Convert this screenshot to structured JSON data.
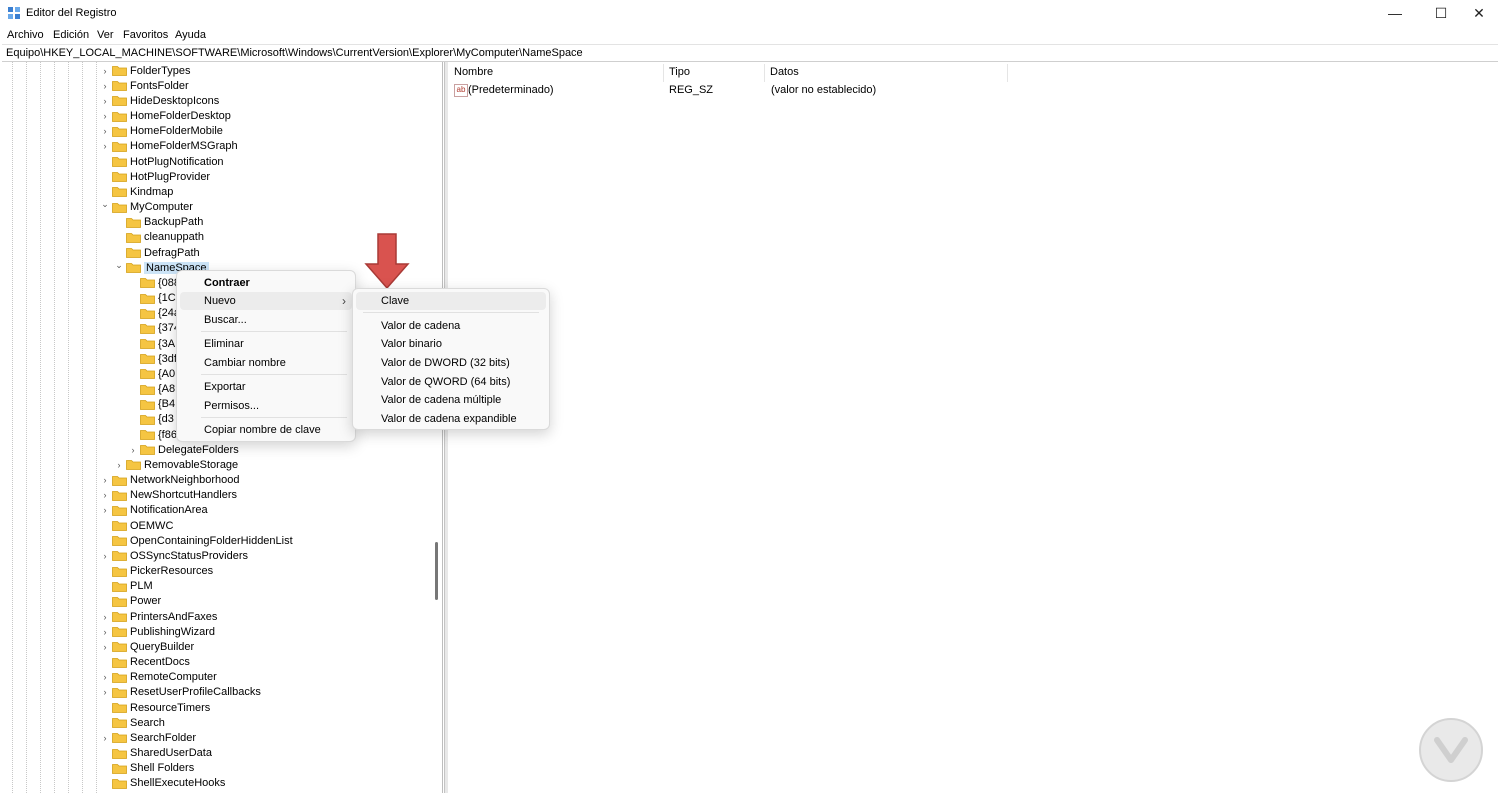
{
  "window": {
    "title": "Editor del Registro",
    "controls": {
      "minimize": "—",
      "maximize": "☐",
      "close": "✕"
    }
  },
  "menu": [
    "Archivo",
    "Edición",
    "Ver",
    "Favoritos",
    "Ayuda"
  ],
  "address": "Equipo\\HKEY_LOCAL_MACHINE\\SOFTWARE\\Microsoft\\Windows\\CurrentVersion\\Explorer\\MyComputer\\NameSpace",
  "tree": {
    "top_items": [
      "FolderTypes",
      "FontsFolder",
      "HideDesktopIcons",
      "HomeFolderDesktop",
      "HomeFolderMobile",
      "HomeFolderMSGraph",
      "HotPlugNotification",
      "HotPlugProvider",
      "Kindmap",
      "MyComputer"
    ],
    "mycomputer_children": [
      "BackupPath",
      "cleanuppath",
      "DefragPath",
      "NameSpace"
    ],
    "namespace_children": [
      "{088",
      "{1C",
      "{24a",
      "{374",
      "{3A",
      "{3df",
      "{A0",
      "{A8",
      "{B4",
      "{d3",
      "{f86"
    ],
    "delegate": "DelegateFolders",
    "removable": "RemovableStorage",
    "bottom_items": [
      "NetworkNeighborhood",
      "NewShortcutHandlers",
      "NotificationArea",
      "OEMWC",
      "OpenContainingFolderHiddenList",
      "OSSyncStatusProviders",
      "PickerResources",
      "PLM",
      "Power",
      "PrintersAndFaxes",
      "PublishingWizard",
      "QueryBuilder",
      "RecentDocs",
      "RemoteComputer",
      "ResetUserProfileCallbacks",
      "ResourceTimers",
      "Search",
      "SearchFolder",
      "SharedUserData",
      "Shell Folders",
      "ShellExecuteHooks"
    ]
  },
  "values_pane": {
    "headers": {
      "name": "Nombre",
      "type": "Tipo",
      "data": "Datos"
    },
    "rows": [
      {
        "icon": "ab",
        "name": "(Predeterminado)",
        "type": "REG_SZ",
        "data": "(valor no establecido)"
      }
    ]
  },
  "context_menu": {
    "collapse": "Contraer",
    "new": "Nuevo",
    "find": "Buscar...",
    "delete": "Eliminar",
    "rename": "Cambiar nombre",
    "export": "Exportar",
    "permissions": "Permisos...",
    "copy_key_name": "Copiar nombre de clave",
    "submenu_arrow": "›"
  },
  "submenu": {
    "key": "Clave",
    "items": [
      "Valor de cadena",
      "Valor binario",
      "Valor de DWORD (32 bits)",
      "Valor de QWORD (64 bits)",
      "Valor de cadena múltiple",
      "Valor de cadena expandible"
    ]
  },
  "icons": {
    "folder": "folder-icon",
    "chevron_right": "›",
    "chevron_down": "⌄",
    "arrow_color": "#d9534f",
    "folder_color": "#f5c542"
  }
}
